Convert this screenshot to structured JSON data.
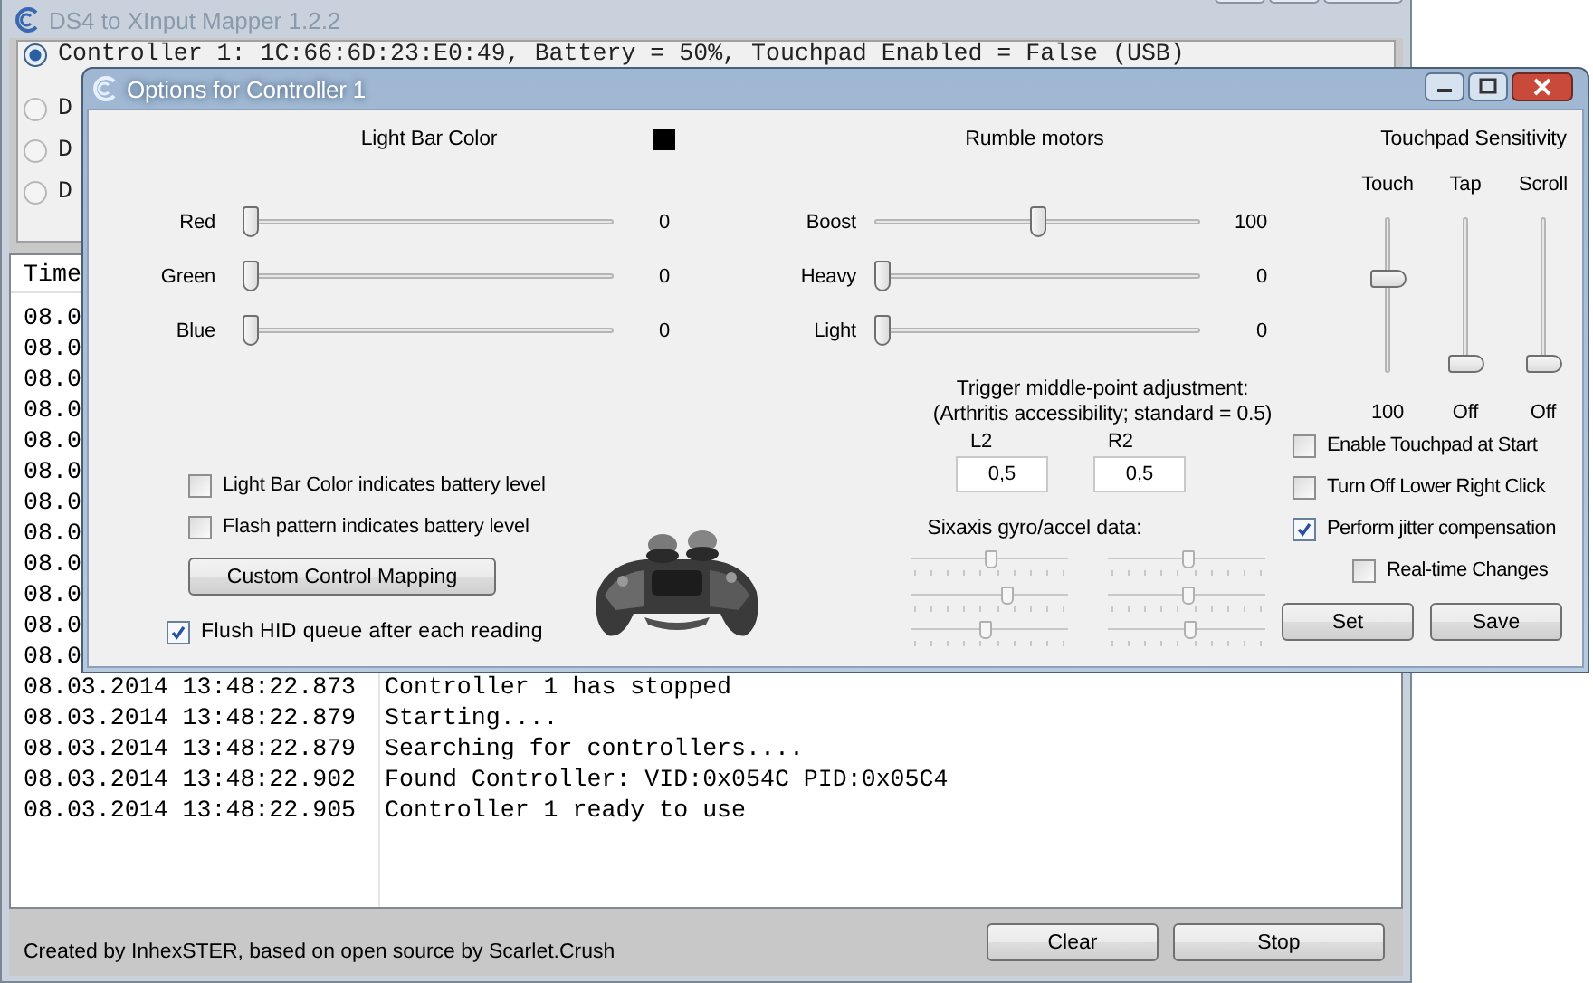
{
  "main_window": {
    "title": "DS4 to XInput Mapper 1.2.2",
    "controllers": [
      {
        "label": "Controller 1: 1C:66:6D:23:E0:49, Battery = 50%, Touchpad Enabled = False (USB)",
        "selected": true
      },
      {
        "label": "D",
        "selected": false
      },
      {
        "label": "D",
        "selected": false
      },
      {
        "label": "D",
        "selected": false
      }
    ],
    "log": {
      "columns": [
        "Time"
      ],
      "rows": [
        {
          "time": "08.0"
        },
        {
          "time": "08.0"
        },
        {
          "time": "08.0"
        },
        {
          "time": "08.0"
        },
        {
          "time": "08.0"
        },
        {
          "time": "08.0"
        },
        {
          "time": "08.0"
        },
        {
          "time": "08.0"
        },
        {
          "time": "08.0"
        },
        {
          "time": "08.0"
        },
        {
          "time": "08.0"
        },
        {
          "time": "08.0"
        },
        {
          "time": "08.03.2014 13:48:22.873",
          "message": "Controller 1 has stopped"
        },
        {
          "time": "08.03.2014 13:48:22.879",
          "message": "Starting...."
        },
        {
          "time": "08.03.2014 13:48:22.879",
          "message": "Searching for controllers...."
        },
        {
          "time": "08.03.2014 13:48:22.902",
          "message": "Found Controller: VID:0x054C PID:0x05C4"
        },
        {
          "time": "08.03.2014 13:48:22.905",
          "message": "Controller 1 ready to use"
        }
      ]
    },
    "status_text": "Created by InhexSTER,  based on open source by Scarlet.Crush",
    "buttons": [
      "Clear",
      "Stop"
    ]
  },
  "options_window": {
    "title": "Options for Controller 1",
    "light_bar": {
      "title": "Light Bar Color",
      "sliders": [
        {
          "label": "Red",
          "level": 0,
          "value": "0"
        },
        {
          "label": "Green",
          "level": 0,
          "value": "0"
        },
        {
          "label": "Blue",
          "level": 0,
          "value": "0"
        }
      ],
      "checkboxes": [
        {
          "label": "Light Bar Color indicates battery level",
          "checked": false
        },
        {
          "label": "Flash pattern indicates battery level",
          "checked": false
        }
      ],
      "mapping_button": "Custom Control Mapping",
      "flush": {
        "label": "Flush HID queue after each reading",
        "checked": true
      }
    },
    "rumble": {
      "title": "Rumble motors",
      "sliders": [
        {
          "label": "Boost",
          "level": 0.5,
          "value": "100"
        },
        {
          "label": "Heavy",
          "level": 0,
          "value": "0"
        },
        {
          "label": "Light",
          "level": 0,
          "value": "0"
        }
      ]
    },
    "trigger": {
      "caption": [
        "Trigger middle-point adjustment:",
        "(Arthritis accessibility; standard = 0.5)"
      ],
      "fields": [
        {
          "label": "L2",
          "value": "0,5"
        },
        {
          "label": "R2",
          "value": "0,5"
        }
      ]
    },
    "sixaxis": {
      "title": "Sixaxis gyro/accel data:",
      "meters": [
        {
          "level": 0.5
        },
        {
          "level": 0.61
        },
        {
          "level": 0.47
        },
        {
          "level": 0.5
        },
        {
          "level": 0.5
        },
        {
          "level": 0.52
        }
      ]
    },
    "touchpad": {
      "title": "Touchpad Sensitivity",
      "sliders": [
        {
          "label": "Touch",
          "level": 0.62,
          "value": "100"
        },
        {
          "label": "Tap",
          "level": 0,
          "value": "Off"
        },
        {
          "label": "Scroll",
          "level": 0,
          "value": "Off"
        }
      ],
      "checkboxes": [
        {
          "label": "Enable Touchpad at Start",
          "checked": false
        },
        {
          "label": "Turn Off Lower Right Click",
          "checked": false
        },
        {
          "label": "Perform jitter compensation",
          "checked": true
        },
        {
          "label": "Real-time Changes",
          "checked": false
        }
      ]
    },
    "buttons": [
      "Set",
      "Save"
    ]
  }
}
